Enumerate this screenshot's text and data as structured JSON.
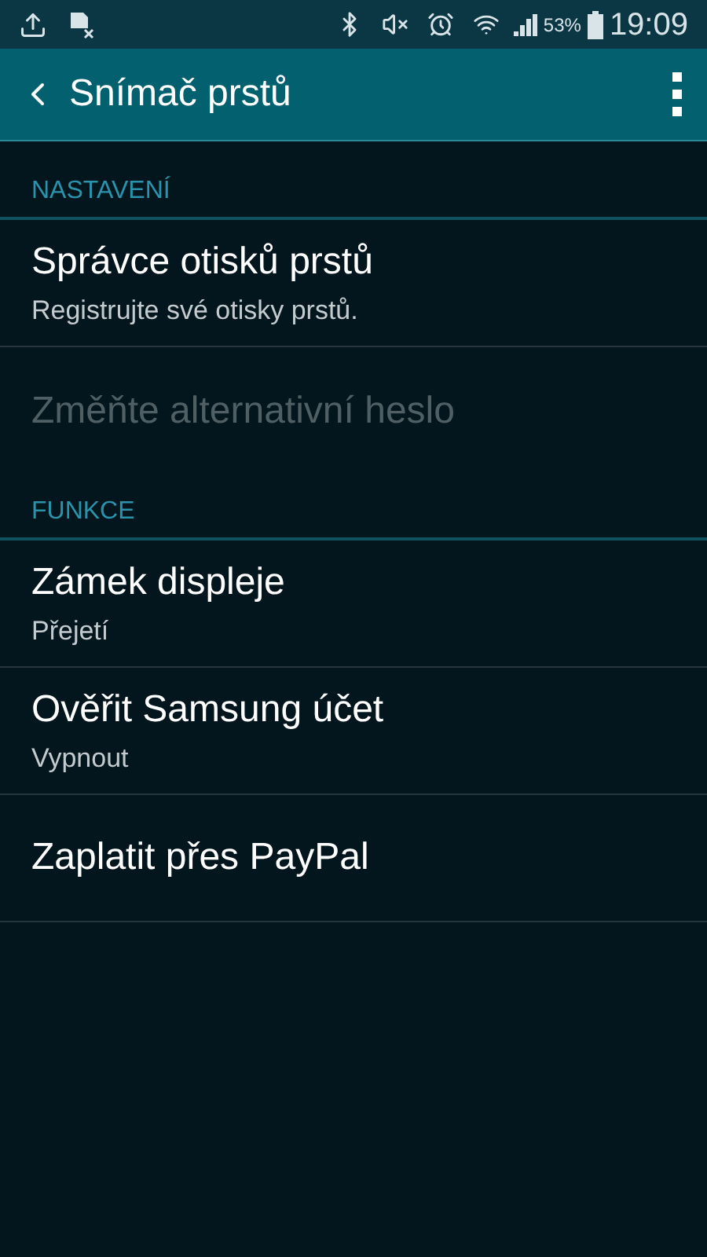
{
  "status_bar": {
    "battery": "53%",
    "time": "19:09"
  },
  "app_bar": {
    "title": "Snímač prstů"
  },
  "sections": [
    {
      "header": "NASTAVENÍ",
      "items": [
        {
          "title": "Správce otisků prstů",
          "subtitle": "Registrujte své otisky prstů.",
          "disabled": false
        },
        {
          "title": "Změňte alternativní heslo",
          "disabled": true
        }
      ]
    },
    {
      "header": "FUNKCE",
      "items": [
        {
          "title": "Zámek displeje",
          "subtitle": "Přejetí",
          "disabled": false
        },
        {
          "title": "Ověřit Samsung účet",
          "subtitle": "Vypnout",
          "disabled": false
        },
        {
          "title": "Zaplatit přes PayPal",
          "disabled": false
        }
      ]
    }
  ]
}
